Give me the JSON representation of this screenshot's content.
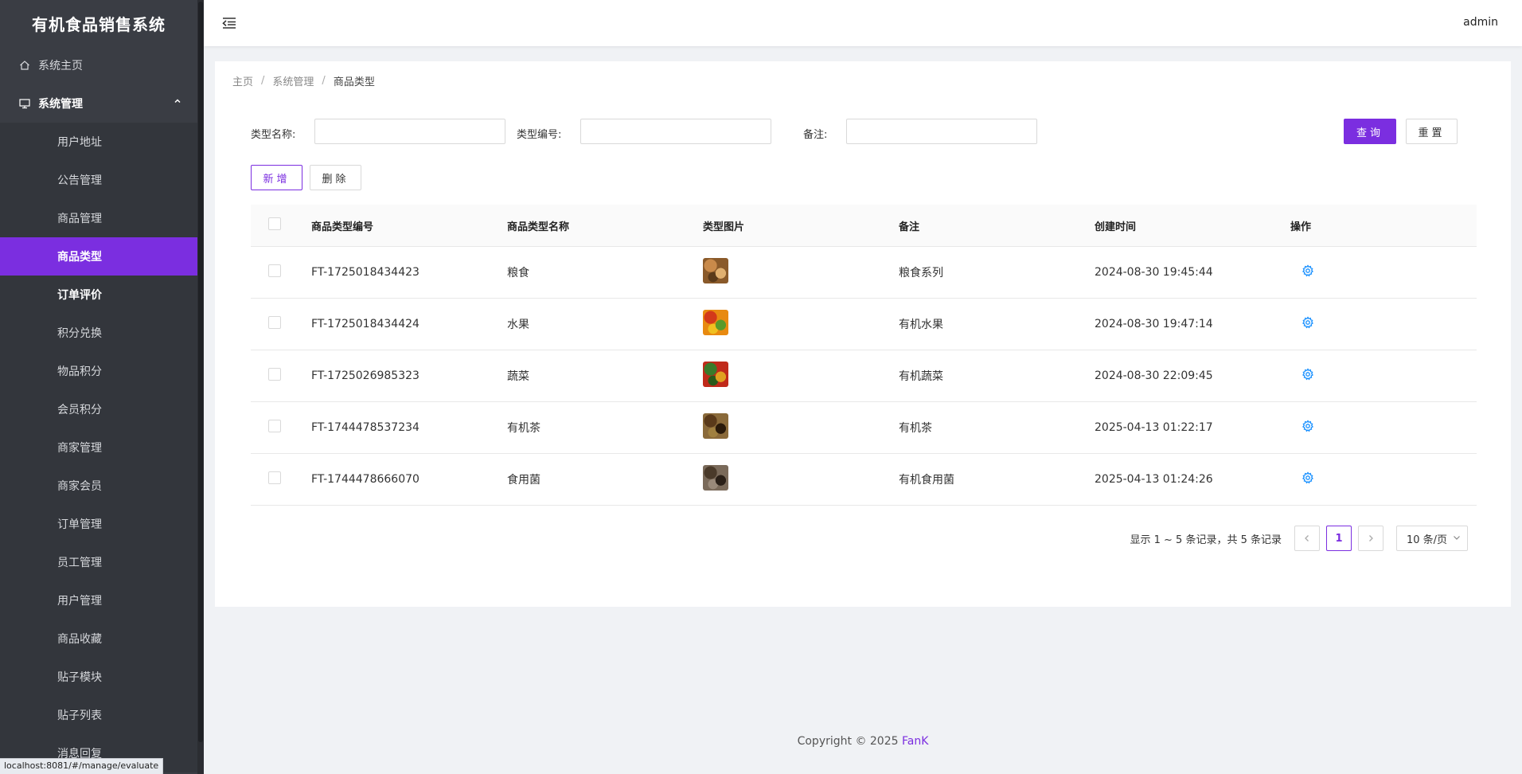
{
  "app": {
    "title": "有机食品销售系统"
  },
  "sidebar": {
    "home": {
      "label": "系统主页",
      "icon": "home-icon"
    },
    "group": {
      "label": "系统管理",
      "icon": "monitor-icon"
    },
    "items": [
      {
        "label": "用户地址"
      },
      {
        "label": "公告管理"
      },
      {
        "label": "商品管理"
      },
      {
        "label": "商品类型"
      },
      {
        "label": "订单评价"
      },
      {
        "label": "积分兑换"
      },
      {
        "label": "物品积分"
      },
      {
        "label": "会员积分"
      },
      {
        "label": "商家管理"
      },
      {
        "label": "商家会员"
      },
      {
        "label": "订单管理"
      },
      {
        "label": "员工管理"
      },
      {
        "label": "用户管理"
      },
      {
        "label": "商品收藏"
      },
      {
        "label": "贴子模块"
      },
      {
        "label": "贴子列表"
      },
      {
        "label": "消息回复"
      }
    ],
    "active_index": 3,
    "hover_index": 4
  },
  "status_bar": {
    "url": "localhost:8081/#/manage/evaluate"
  },
  "header": {
    "user": "admin"
  },
  "breadcrumb": {
    "home": "主页",
    "sep": "/",
    "parent": "系统管理",
    "current": "商品类型"
  },
  "search": {
    "name_label": "类型名称:",
    "code_label": "类型编号:",
    "remark_label": "备注:",
    "name_value": "",
    "code_value": "",
    "remark_value": "",
    "query_btn": "查询",
    "reset_btn": "重置"
  },
  "actions": {
    "add_btn": "新增",
    "delete_btn": "删除"
  },
  "table": {
    "headers": [
      "商品类型编号",
      "商品类型名称",
      "类型图片",
      "备注",
      "创建时间",
      "操作"
    ],
    "rows": [
      {
        "code": "FT-1725018434423",
        "name": "粮食",
        "remark": "粮食系列",
        "created": "2024-08-30 19:45:44",
        "image": "grains-image"
      },
      {
        "code": "FT-1725018434424",
        "name": "水果",
        "remark": "有机水果",
        "created": "2024-08-30 19:47:14",
        "image": "fruits-image"
      },
      {
        "code": "FT-1725026985323",
        "name": "蔬菜",
        "remark": "有机蔬菜",
        "created": "2024-08-30 22:09:45",
        "image": "vegetables-image"
      },
      {
        "code": "FT-1744478537234",
        "name": "有机茶",
        "remark": "有机茶",
        "created": "2025-04-13 01:22:17",
        "image": "tea-image"
      },
      {
        "code": "FT-1744478666070",
        "name": "食用菌",
        "remark": "有机食用菌",
        "created": "2025-04-13 01:24:26",
        "image": "mushroom-image"
      }
    ]
  },
  "pagination": {
    "summary": "显示 1 ~ 5 条记录，共 5 条记录",
    "current": "1",
    "page_size": "10 条/页"
  },
  "footer": {
    "copyright": "Copyright © 2025",
    "brand": "FanK"
  },
  "colors": {
    "accent": "#7b2ee0",
    "sidebar_bg": "#3a3d44",
    "op_icon": "#1890ff"
  }
}
